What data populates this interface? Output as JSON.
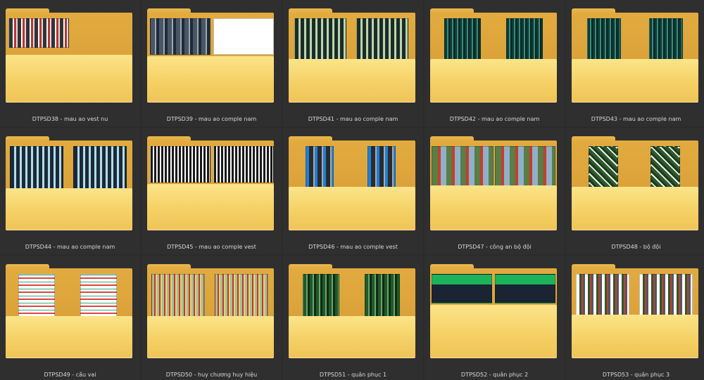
{
  "folders": [
    {
      "label": "DTPSD38 - mau ao vest nu",
      "thumbs": [
        "p-red",
        "none"
      ]
    },
    {
      "label": "DTPSD39 - mau ao comple nam",
      "thumbs": [
        "p-grey",
        "p-white"
      ]
    },
    {
      "label": "DTPSD41 - mau ao comple nam",
      "thumbs": [
        "p-paleg",
        "p-paleg"
      ]
    },
    {
      "label": "DTPSD42 - mau ao comple nam",
      "thumbs": [
        "p-dteal",
        "p-dteal"
      ]
    },
    {
      "label": "DTPSD43 - mau ao comple nam",
      "thumbs": [
        "p-dteal",
        "p-dteal"
      ]
    },
    {
      "label": "DTPSD44 - mau ao comple nam",
      "thumbs": [
        "p-lblue",
        "p-lblue"
      ]
    },
    {
      "label": "DTPSD45 - mau ao comple vest",
      "thumbs": [
        "p-wdots",
        "p-wdots"
      ]
    },
    {
      "label": "DTPSD46 - mau ao comple vest",
      "thumbs": [
        "p-blue",
        "p-blue"
      ]
    },
    {
      "label": "DTPSD47 - công an bộ đội",
      "thumbs": [
        "p-army",
        "p-army"
      ]
    },
    {
      "label": "DTPSD48 - bộ đội",
      "thumbs": [
        "p-camo",
        "p-camo"
      ]
    },
    {
      "label": "DTPSD49 - cầu vai",
      "thumbs": [
        "p-flags",
        "p-flags"
      ]
    },
    {
      "label": "DTPSD50 - huy chương huy hiệu",
      "thumbs": [
        "p-medal",
        "p-medal"
      ]
    },
    {
      "label": "DTPSD51 - quân phục 1",
      "thumbs": [
        "p-green",
        "p-green"
      ]
    },
    {
      "label": "DTPSD52 - quân phục 2",
      "thumbs": [
        "p-band",
        "p-band"
      ]
    },
    {
      "label": "DTPSD53 - quân phục 3",
      "thumbs": [
        "p-mixed",
        "p-mixed"
      ]
    }
  ]
}
